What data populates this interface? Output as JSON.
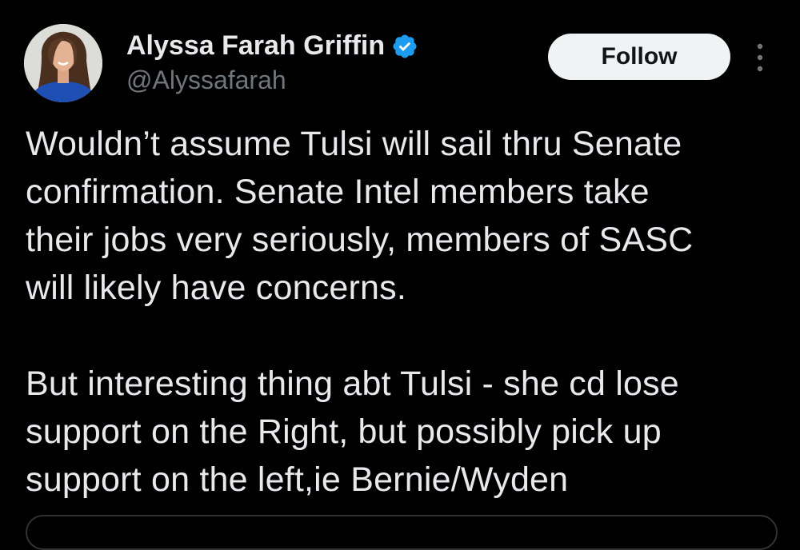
{
  "author": {
    "display_name": "Alyssa Farah Griffin",
    "handle": "@Alyssafarah",
    "verified": true,
    "avatar_icon": "profile-photo"
  },
  "actions": {
    "follow_label": "Follow",
    "more_icon": "more-vertical-icon"
  },
  "tweet": {
    "paragraphs": [
      "Wouldn’t assume Tulsi will sail thru Senate\nconfirmation. Senate Intel members take\ntheir jobs very seriously, members of SASC\nwill likely have concerns.",
      "But interesting thing abt Tulsi - she cd lose\nsupport on the Right, but possibly pick up\nsupport on the left,ie Bernie/Wyden"
    ]
  },
  "colors": {
    "background": "#000000",
    "text_primary": "#e7e9ea",
    "text_secondary": "#71767b",
    "verified_blue": "#1d9bf0",
    "follow_bg": "#eff3f4",
    "follow_text": "#0f1419"
  }
}
